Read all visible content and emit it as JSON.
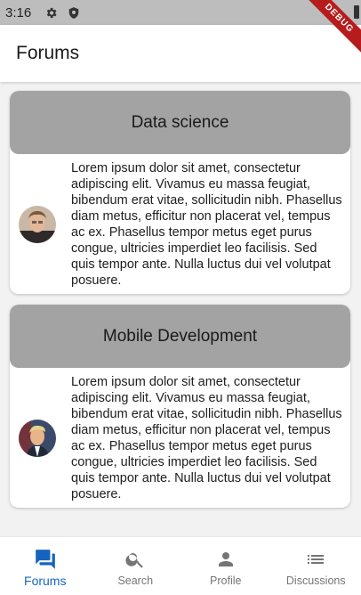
{
  "status_bar": {
    "time": "3:16",
    "icons": [
      "gear-icon",
      "shield-icon",
      "battery-icon"
    ]
  },
  "debug_banner": "DEBUG",
  "app_bar": {
    "title": "Forums"
  },
  "forums": [
    {
      "title": "Data science",
      "text": "Lorem ipsum dolor sit amet, consectetur adipiscing elit. Vivamus eu massa feugiat, bibendum erat vitae, sollicitudin nibh. Phasellus diam metus, efficitur non placerat vel, tempus ac ex. Phasellus tempor metus eget purus congue, ultricies imperdiet leo facilisis. Sed quis tempor ante. Nulla luctus dui vel volutpat posuere."
    },
    {
      "title": "Mobile Development",
      "text": "Lorem ipsum dolor sit amet, consectetur adipiscing elit. Vivamus eu massa feugiat, bibendum erat vitae, sollicitudin nibh. Phasellus diam metus, efficitur non placerat vel, tempus ac ex. Phasellus tempor metus eget purus congue, ultricies imperdiet leo facilisis. Sed quis tempor ante. Nulla luctus dui vel volutpat posuere."
    }
  ],
  "bottom_nav": {
    "items": [
      {
        "label": "Forums",
        "icon": "forum-icon",
        "active": true
      },
      {
        "label": "Search",
        "icon": "search-icon",
        "active": false
      },
      {
        "label": "Profile",
        "icon": "person-icon",
        "active": false
      },
      {
        "label": "Discussions",
        "icon": "list-icon",
        "active": false
      }
    ]
  },
  "colors": {
    "accent": "#1565c0",
    "card_header": "#a3a3a3",
    "inactive": "#757575"
  }
}
